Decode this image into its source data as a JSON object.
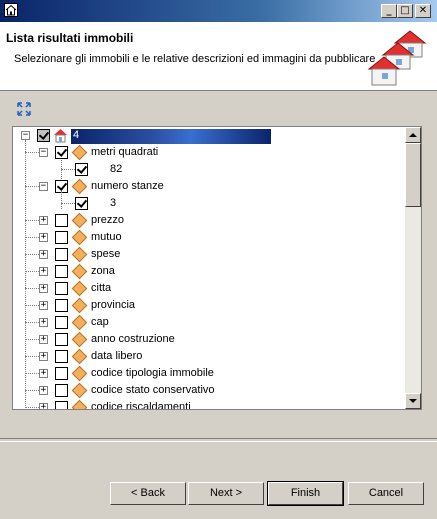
{
  "window": {
    "minimize_glyph": "_",
    "maximize_glyph": "□",
    "close_glyph": "✕"
  },
  "header": {
    "title": "Lista risultati immobili",
    "description": "Selezionare gli immobili e le relative descrizioni ed immagini da pubblicare"
  },
  "tree": {
    "root_label": "4",
    "items": [
      {
        "label": "metri quadrati",
        "expanded": true,
        "checked": true,
        "child": "82"
      },
      {
        "label": "numero stanze",
        "expanded": true,
        "checked": true,
        "child": "3"
      },
      {
        "label": "prezzo"
      },
      {
        "label": "mutuo"
      },
      {
        "label": "spese"
      },
      {
        "label": "zona"
      },
      {
        "label": "citta"
      },
      {
        "label": "provincia"
      },
      {
        "label": "cap"
      },
      {
        "label": "anno costruzione"
      },
      {
        "label": "data libero"
      },
      {
        "label": "codice tipologia immobile"
      },
      {
        "label": "codice stato conservativo"
      },
      {
        "label": "codice riscaldamenti"
      }
    ]
  },
  "buttons": {
    "back": "< Back",
    "next": "Next >",
    "finish": "Finish",
    "cancel": "Cancel"
  },
  "colors": {
    "title_bar": "#0a246a",
    "window_bg": "#d4d0c8",
    "house_roof": "#e03030"
  }
}
